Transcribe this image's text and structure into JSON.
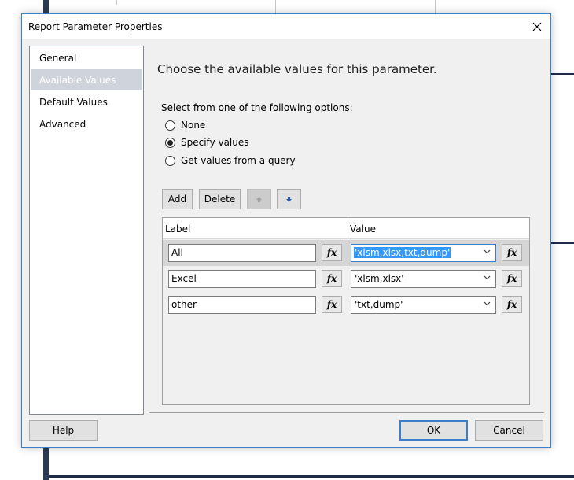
{
  "dialog": {
    "title": "Report Parameter Properties",
    "close_icon": "close-icon"
  },
  "nav": {
    "items": [
      {
        "label": "General"
      },
      {
        "label": "Available Values",
        "selected": true
      },
      {
        "label": "Default Values"
      },
      {
        "label": "Advanced"
      }
    ]
  },
  "content": {
    "heading": "Choose the available values for this parameter.",
    "options_label": "Select from one of the following options:",
    "options": [
      {
        "label": "None",
        "checked": false
      },
      {
        "label": "Specify values",
        "checked": true
      },
      {
        "label": "Get values from a query",
        "checked": false
      }
    ]
  },
  "toolbar": {
    "add_label": "Add",
    "delete_label": "Delete",
    "move_up_icon": "arrow-up-icon",
    "move_down_icon": "arrow-down-icon"
  },
  "grid": {
    "columns": [
      "Label",
      "Value"
    ],
    "rows": [
      {
        "label": "All",
        "value": "'xlsm,xlsx,txt,dump'",
        "fx": "fx"
      },
      {
        "label": "Excel",
        "value": "'xlsm,xlsx'",
        "fx": "fx"
      },
      {
        "label": "other",
        "value": "'txt,dump'",
        "fx": "fx"
      }
    ]
  },
  "footer": {
    "help_label": "Help",
    "ok_label": "OK",
    "cancel_label": "Cancel"
  },
  "colors": {
    "accent": "#3c7fc8",
    "selection": "#3399ff",
    "nav_selected": "#cfd3dc"
  }
}
